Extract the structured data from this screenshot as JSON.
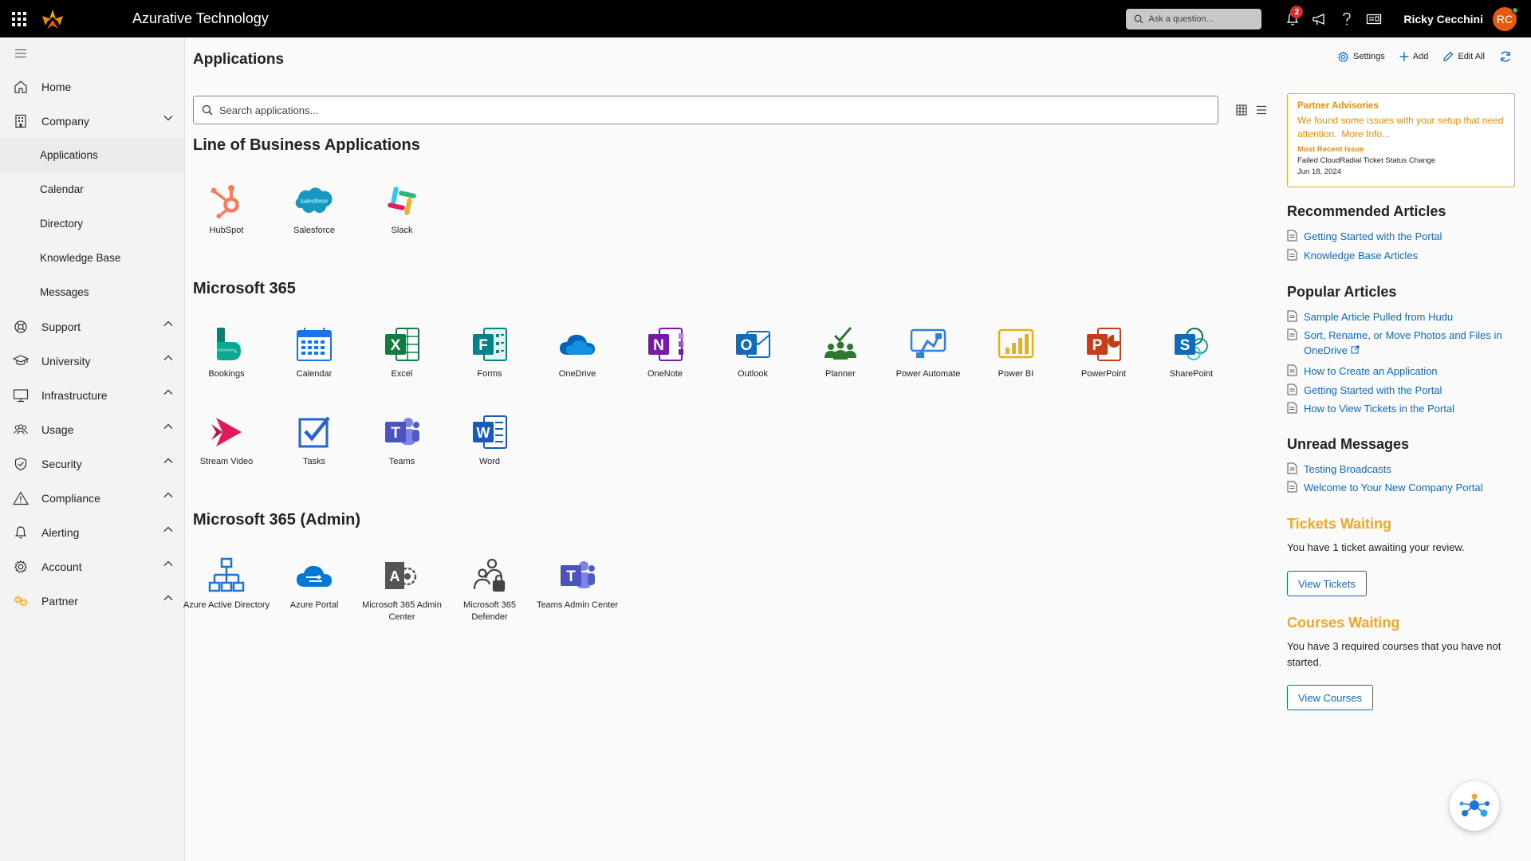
{
  "header": {
    "app_title": "Azurative Technology",
    "ask_placeholder": "Ask a question...",
    "notification_count": "2",
    "user_name": "Ricky Cecchini",
    "user_initials": "RC"
  },
  "sidebar": {
    "items": [
      {
        "label": "Home"
      },
      {
        "label": "Company"
      },
      {
        "label": "Support"
      },
      {
        "label": "University"
      },
      {
        "label": "Infrastructure"
      },
      {
        "label": "Usage"
      },
      {
        "label": "Security"
      },
      {
        "label": "Compliance"
      },
      {
        "label": "Alerting"
      },
      {
        "label": "Account"
      },
      {
        "label": "Partner"
      }
    ],
    "company_sub": [
      "Applications",
      "Calendar",
      "Directory",
      "Knowledge Base",
      "Messages"
    ]
  },
  "main": {
    "title": "Applications",
    "search_placeholder": "Search applications...",
    "sections": [
      {
        "title": "Line of Business Applications",
        "apps": [
          "HubSpot",
          "Salesforce",
          "Slack"
        ]
      },
      {
        "title": "Microsoft 365",
        "apps": [
          "Bookings",
          "Calendar",
          "Excel",
          "Forms",
          "OneDrive",
          "OneNote",
          "Outlook",
          "Planner",
          "Power Automate",
          "Power BI",
          "PowerPoint",
          "SharePoint",
          "Stream Video",
          "Tasks",
          "Teams",
          "Word"
        ]
      },
      {
        "title": "Microsoft 365 (Admin)",
        "apps": [
          "Azure Active Directory",
          "Azure Portal",
          "Microsoft 365 Admin Center",
          "Microsoft 365 Defender",
          "Teams Admin Center"
        ]
      }
    ],
    "salesforce_logo_text": "salesforce"
  },
  "toolbar": {
    "settings": "Settings",
    "add": "Add",
    "edit_all": "Edit All"
  },
  "advisory": {
    "title": "Partner Advisories",
    "body": "We found some issues with your setup that need attention.",
    "more": "More Info...",
    "recent_label": "Most Recent Issue",
    "recent_issue": "Failed CloudRadial Ticket Status Change",
    "recent_date": "Jun 18, 2024"
  },
  "recommended": {
    "title": "Recommended Articles",
    "links": [
      "Getting Started with the Portal",
      "Knowledge Base Articles"
    ]
  },
  "popular": {
    "title": "Popular Articles",
    "links": [
      "Sample Article Pulled from Hudu",
      "Sort, Rename, or Move Photos and Files in OneDrive",
      "How to Create an Application",
      "Getting Started with the Portal",
      "How to View Tickets in the Portal"
    ]
  },
  "unread": {
    "title": "Unread Messages",
    "links": [
      "Testing Broadcasts",
      "Welcome to Your New Company Portal"
    ]
  },
  "tickets": {
    "title": "Tickets Waiting",
    "text": "You have 1 ticket awaiting your review.",
    "button": "View Tickets"
  },
  "courses": {
    "title": "Courses Waiting",
    "text": "You have 3 required courses that you have not started.",
    "button": "View Courses"
  },
  "colors": {
    "accent": "#0b6ac9",
    "warning": "#f5a623",
    "topbar": "#000000",
    "avatar": "#e8590c"
  }
}
